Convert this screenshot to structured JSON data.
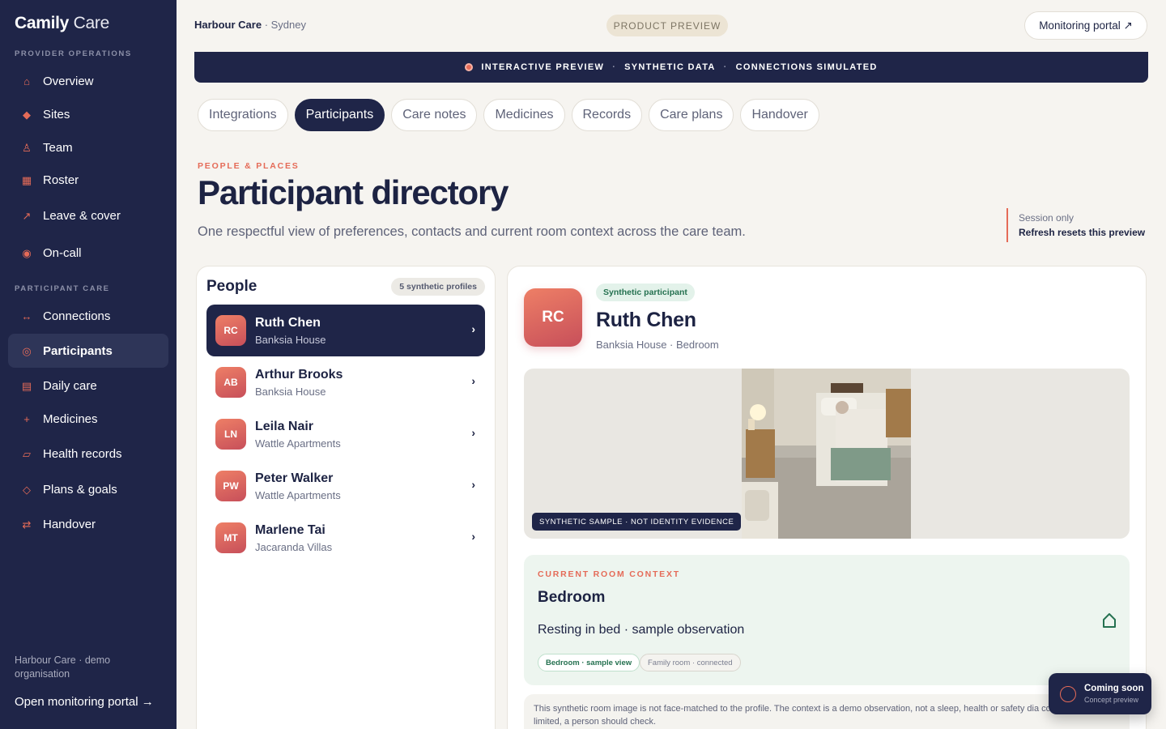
{
  "brand": {
    "bold": "Camily",
    "light": "Care"
  },
  "sidebar": {
    "section_ops": "PROVIDER OPERATIONS",
    "section_care": "PARTICIPANT CARE",
    "items": [
      {
        "label": "Overview",
        "icon": "home-icon"
      },
      {
        "label": "Sites",
        "icon": "diamond-icon"
      },
      {
        "label": "Team",
        "icon": "person-icon"
      },
      {
        "label": "Roster",
        "icon": "grid-icon"
      },
      {
        "label": "Leave & cover",
        "icon": "arrow-icon"
      },
      {
        "label": "On-call",
        "icon": "target-icon"
      },
      {
        "label": "Connections",
        "icon": "link-arrows-icon"
      },
      {
        "label": "Participants",
        "icon": "ring-icon",
        "active": true
      },
      {
        "label": "Daily care",
        "icon": "list-icon"
      },
      {
        "label": "Medicines",
        "icon": "plus-icon"
      },
      {
        "label": "Health records",
        "icon": "folder-icon"
      },
      {
        "label": "Plans & goals",
        "icon": "diamond-outline-icon"
      },
      {
        "label": "Handover",
        "icon": "swap-icon"
      }
    ],
    "footer_org": "Harbour Care · demo organisation",
    "footer_link": "Open monitoring portal →"
  },
  "header": {
    "org_name": "Harbour Care",
    "org_city": " · Sydney",
    "preview_pill": "PRODUCT PREVIEW",
    "portal_button": "Monitoring portal ↗"
  },
  "banner": {
    "part1": "INTERACTIVE PREVIEW",
    "part2": "SYNTHETIC DATA",
    "part3": "CONNECTIONS SIMULATED",
    "separator": "·"
  },
  "tabs": [
    {
      "label": "Integrations"
    },
    {
      "label": "Participants",
      "active": true
    },
    {
      "label": "Care notes"
    },
    {
      "label": "Medicines"
    },
    {
      "label": "Records"
    },
    {
      "label": "Care plans"
    },
    {
      "label": "Handover"
    }
  ],
  "page": {
    "eyebrow": "PEOPLE & PLACES",
    "title": "Participant directory",
    "subtitle": "One respectful view of preferences, contacts and current room context across the care team.",
    "session_label": "Session only",
    "session_note": "Refresh resets this preview"
  },
  "people": {
    "title": "People",
    "count_badge": "5 synthetic profiles",
    "list": [
      {
        "initials": "RC",
        "name": "Ruth Chen",
        "site": "Banksia House",
        "active": true
      },
      {
        "initials": "AB",
        "name": "Arthur Brooks",
        "site": "Banksia House"
      },
      {
        "initials": "LN",
        "name": "Leila Nair",
        "site": "Wattle Apartments"
      },
      {
        "initials": "PW",
        "name": "Peter Walker",
        "site": "Wattle Apartments"
      },
      {
        "initials": "MT",
        "name": "Marlene Tai",
        "site": "Jacaranda Villas"
      }
    ],
    "chevron": "›"
  },
  "detail": {
    "initials": "RC",
    "badge": "Synthetic participant",
    "name": "Ruth Chen",
    "location": "Banksia House · Bedroom",
    "photo_caption": "SYNTHETIC SAMPLE · NOT IDENTITY EVIDENCE",
    "context_eyebrow": "CURRENT ROOM CONTEXT",
    "context_room": "Bedroom",
    "context_observation": "Resting in bed · sample observation",
    "chip_primary": "Bedroom · sample view",
    "chip_secondary": "Family room · connected",
    "note": "This synthetic room image is not face-matched to the profile. The context is a demo observation, not a sleep, health or safety dia confidence is limited, a person should check."
  },
  "toast": {
    "title": "Coming soon",
    "subtitle": "Concept preview"
  },
  "colors": {
    "navy": "#1f2548",
    "accent": "#e56b58",
    "green": "#257150",
    "background": "#f6f4f0"
  }
}
